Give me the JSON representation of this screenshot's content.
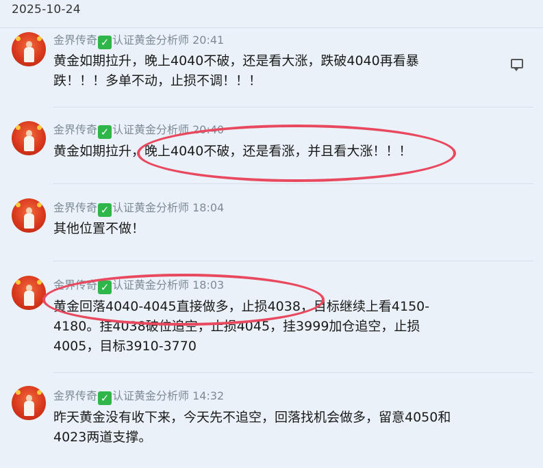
{
  "date_header": "2025-10-24",
  "messages": [
    {
      "sender": "金界传奇",
      "badge": "认证黄金分析师",
      "time": "20:41",
      "lines": [
        "黄金如期拉升，晚上4040不破，还是看大涨，跌破4040再看暴",
        "跌！！！多单不动，止损不调！！！"
      ]
    },
    {
      "sender": "金界传奇",
      "badge": "认证黄金分析师",
      "time": "20:40",
      "lines": [
        "黄金如期拉升，晚上4040不破，还是看涨，并且看大涨！！！"
      ]
    },
    {
      "sender": "金界传奇",
      "badge": "认证黄金分析师",
      "time": "18:04",
      "lines": [
        "其他位置不做！"
      ]
    },
    {
      "sender": "金界传奇",
      "badge": "认证黄金分析师",
      "time": "18:03",
      "lines": [
        "黄金回落4040-4045直接做多，止损4038，目标继续上看4150-",
        "4180。挂4038破位追空，止损4045，挂3999加仓追空，止损",
        "4005，目标3910-3770"
      ]
    },
    {
      "sender": "金界传奇",
      "badge": "认证黄金分析师",
      "time": "14:32",
      "lines": [
        "昨天黄金没有收下来，今天先不追空，回落找机会做多，留意4050和",
        "4023两道支撑。"
      ]
    }
  ],
  "icons": {
    "verified": "check-mark-icon",
    "comment": "comment-icon"
  },
  "colors": {
    "background": "#eaf1f8",
    "annotation_circle": "#e9495f",
    "verified_badge": "#2fb64a"
  }
}
